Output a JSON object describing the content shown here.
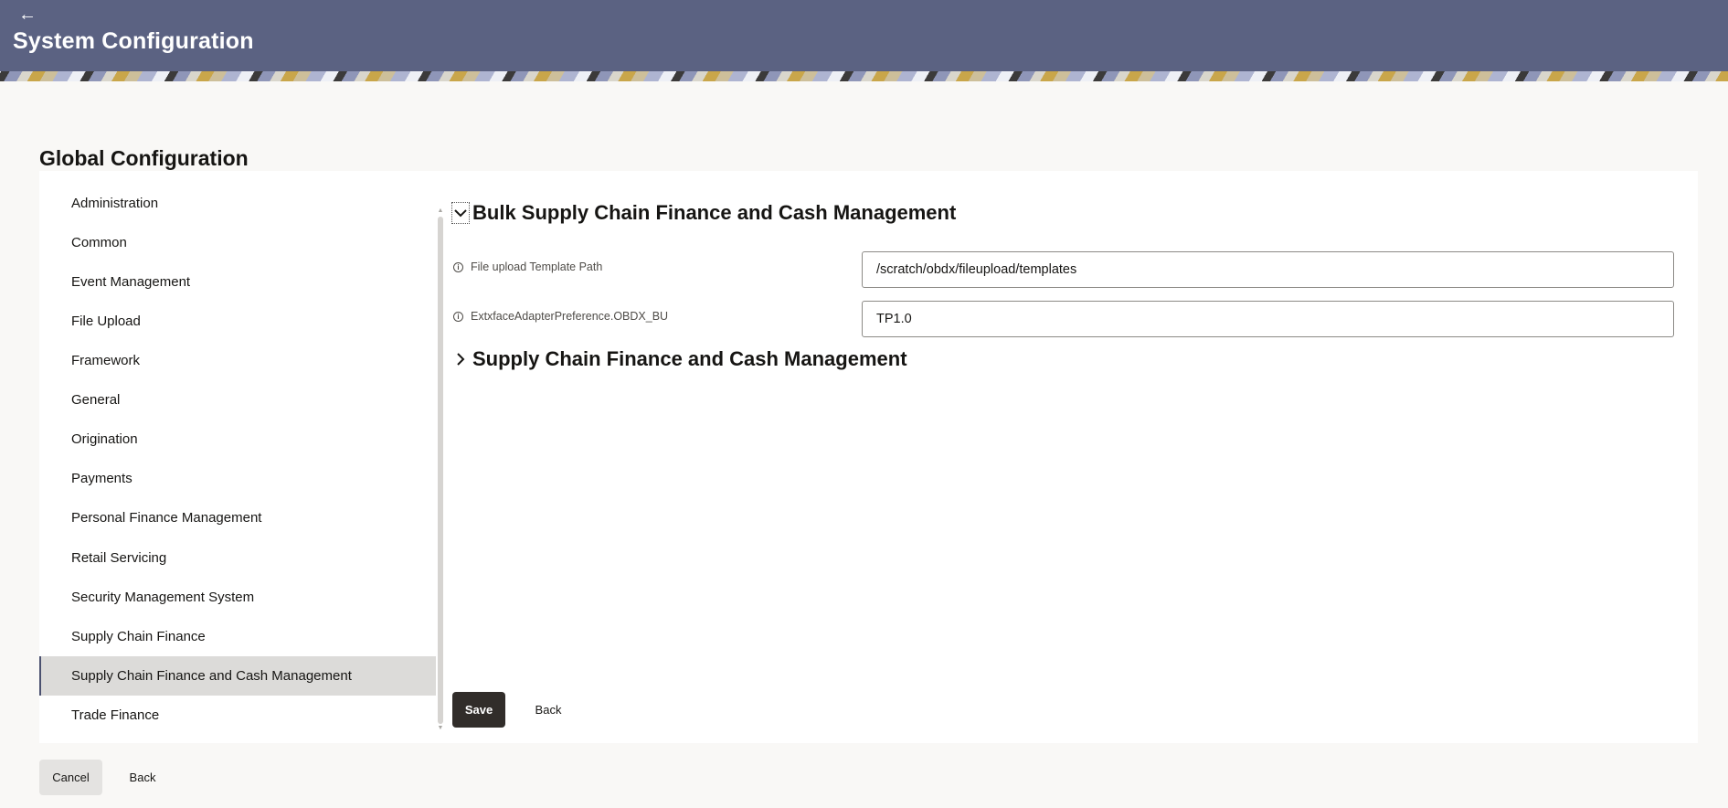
{
  "header": {
    "back_icon": "back-arrow-icon",
    "title": "System Configuration",
    "background_color": "#5b6282"
  },
  "page": {
    "title": "Global Configuration"
  },
  "sidebar": {
    "items": [
      {
        "label": "Administration"
      },
      {
        "label": "Common"
      },
      {
        "label": "Event Management"
      },
      {
        "label": "File Upload"
      },
      {
        "label": "Framework"
      },
      {
        "label": "General"
      },
      {
        "label": "Origination"
      },
      {
        "label": "Payments"
      },
      {
        "label": "Personal Finance Management"
      },
      {
        "label": "Retail Servicing"
      },
      {
        "label": "Security Management System"
      },
      {
        "label": "Supply Chain Finance"
      },
      {
        "label": "Supply Chain Finance and Cash Management",
        "active": true
      },
      {
        "label": "Trade Finance"
      }
    ]
  },
  "content": {
    "sections": [
      {
        "title": "Bulk Supply Chain Finance and Cash Management",
        "expanded": true,
        "icon": "chevron-down-icon",
        "fields": [
          {
            "label": "File upload Template Path",
            "value": "/scratch/obdx/fileupload/templates"
          },
          {
            "label": "ExtxfaceAdapterPreference.OBDX_BU",
            "value": "TP1.0"
          }
        ]
      },
      {
        "title": "Supply Chain Finance and Cash Management",
        "expanded": false,
        "icon": "chevron-right-icon"
      }
    ],
    "save_label": "Save",
    "back_label": "Back"
  },
  "footer": {
    "cancel_label": "Cancel",
    "back_label": "Back"
  },
  "colors": {
    "primary_button": "#312d2a",
    "active_nav_bg": "#dcdbd9",
    "active_nav_border": "#4b5170"
  }
}
